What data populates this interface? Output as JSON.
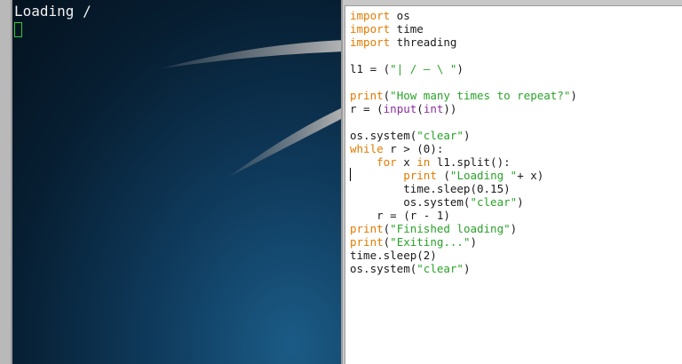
{
  "terminal": {
    "output_line": "Loading /"
  },
  "editor": {
    "lines": [
      [
        {
          "t": "import",
          "c": "kw"
        },
        {
          "t": " os",
          "c": ""
        }
      ],
      [
        {
          "t": "import",
          "c": "kw"
        },
        {
          "t": " time",
          "c": ""
        }
      ],
      [
        {
          "t": "import",
          "c": "kw"
        },
        {
          "t": " threading",
          "c": ""
        }
      ],
      [],
      [
        {
          "t": "l1 = (",
          "c": ""
        },
        {
          "t": "\"| / — \\ \"",
          "c": "str"
        },
        {
          "t": ")",
          "c": ""
        }
      ],
      [],
      [
        {
          "t": "print",
          "c": "kw"
        },
        {
          "t": "(",
          "c": ""
        },
        {
          "t": "\"How many times to repeat?\"",
          "c": "str"
        },
        {
          "t": ")",
          "c": ""
        }
      ],
      [
        {
          "t": "r = (",
          "c": ""
        },
        {
          "t": "input",
          "c": "bi"
        },
        {
          "t": "(",
          "c": ""
        },
        {
          "t": "int",
          "c": "bi"
        },
        {
          "t": "))",
          "c": ""
        }
      ],
      [],
      [
        {
          "t": "os.system(",
          "c": ""
        },
        {
          "t": "\"clear\"",
          "c": "str"
        },
        {
          "t": ")",
          "c": ""
        }
      ],
      [
        {
          "t": "while",
          "c": "kw"
        },
        {
          "t": " r > (0):",
          "c": ""
        }
      ],
      [
        {
          "t": "    ",
          "c": ""
        },
        {
          "t": "for",
          "c": "kw"
        },
        {
          "t": " x ",
          "c": ""
        },
        {
          "t": "in",
          "c": "kw"
        },
        {
          "t": " l1.split():",
          "c": ""
        }
      ],
      [
        {
          "t": "        ",
          "c": ""
        },
        {
          "t": "print",
          "c": "kw"
        },
        {
          "t": " (",
          "c": ""
        },
        {
          "t": "\"Loading \"",
          "c": "str"
        },
        {
          "t": "+ x)",
          "c": ""
        }
      ],
      [
        {
          "t": "        time.sleep(0.15)",
          "c": ""
        }
      ],
      [
        {
          "t": "        os.system(",
          "c": ""
        },
        {
          "t": "\"clear\"",
          "c": "str"
        },
        {
          "t": ")",
          "c": ""
        }
      ],
      [
        {
          "t": "    r = (r - 1)",
          "c": ""
        }
      ],
      [
        {
          "t": "print",
          "c": "kw"
        },
        {
          "t": "(",
          "c": ""
        },
        {
          "t": "\"Finished loading\"",
          "c": "str"
        },
        {
          "t": ")",
          "c": ""
        }
      ],
      [
        {
          "t": "print",
          "c": "kw"
        },
        {
          "t": "(",
          "c": ""
        },
        {
          "t": "\"Exiting...\"",
          "c": "str"
        },
        {
          "t": ")",
          "c": ""
        }
      ],
      [
        {
          "t": "time.sleep(2)",
          "c": ""
        }
      ],
      [
        {
          "t": "os.system(",
          "c": ""
        },
        {
          "t": "\"clear\"",
          "c": "str"
        },
        {
          "t": ")",
          "c": ""
        }
      ]
    ]
  },
  "colors": {
    "keyword": "#e07b00",
    "string": "#2aa22a",
    "builtin": "#8a2f9e",
    "cursor": "#2ecc40"
  }
}
